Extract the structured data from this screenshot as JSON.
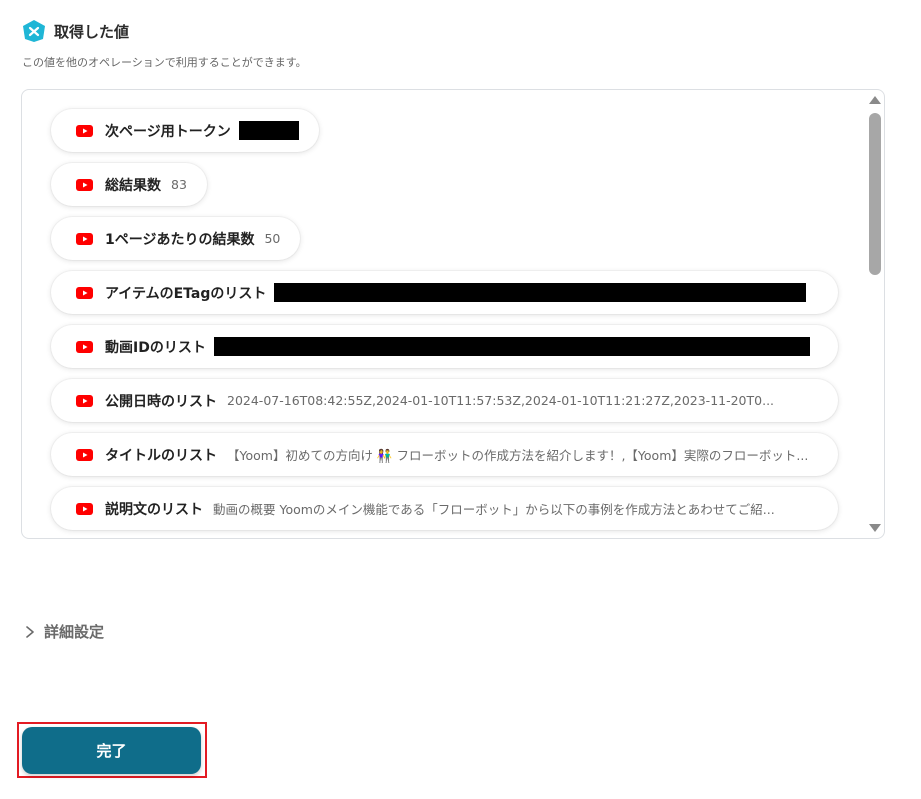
{
  "header": {
    "title": "取得した値",
    "subtitle": "この値を他のオペレーションで利用することができます。"
  },
  "items": [
    {
      "label": "次ページ用トークン",
      "value": "",
      "redacted": true
    },
    {
      "label": "総結果数",
      "value": "83"
    },
    {
      "label": "1ページあたりの結果数",
      "value": "50"
    },
    {
      "label": "アイテムのETagのリスト",
      "value": "",
      "redacted": true
    },
    {
      "label": "動画IDのリスト",
      "value": "",
      "redacted": true
    },
    {
      "label": "公開日時のリスト",
      "value": "2024-07-16T08:42:55Z,2024-01-10T11:57:53Z,2024-01-10T11:21:27Z,2023-11-20T0..."
    },
    {
      "label": "タイトルのリスト",
      "value": "【Yoom】初めての方向け 👫 フローボットの作成方法を紹介します！,【Yoom】実際のフローボット..."
    },
    {
      "label": "説明文のリスト",
      "value": "動画の概要 Yoomのメイン機能である「フローボット」から以下の事例を作成方法とあわせてご紹..."
    }
  ],
  "details": {
    "label": "詳細設定"
  },
  "actions": {
    "done_label": "完了"
  },
  "colors": {
    "accent": "#0f6d8a",
    "youtube": "#ff0000",
    "highlight": "#e31b23",
    "logo": "#1fb6d6"
  },
  "icons": {
    "logo": "yoom-logo-icon",
    "item": "youtube-icon",
    "details": "chevron-right-icon"
  }
}
